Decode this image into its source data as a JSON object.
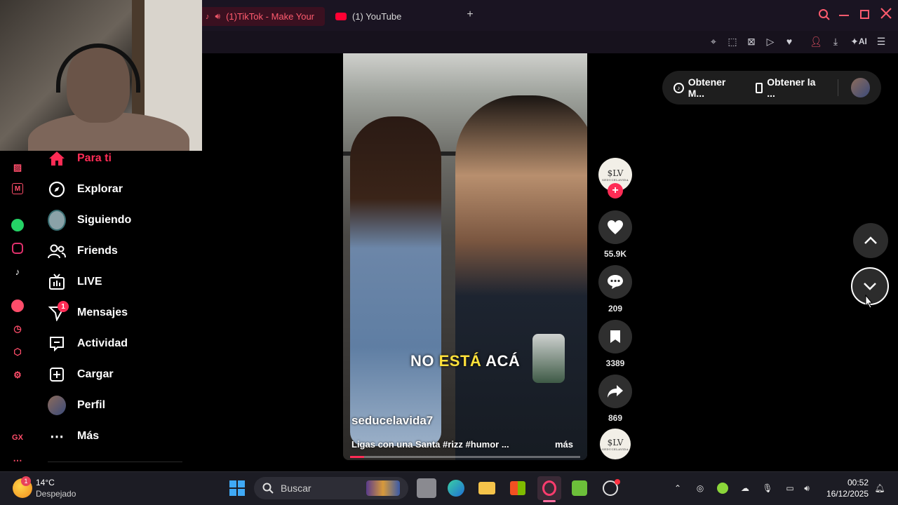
{
  "tabs": [
    {
      "label": "(1)TikTok - Make Your",
      "active": true
    },
    {
      "label": "(1) YouTube",
      "active": false
    }
  ],
  "new_tab": "+",
  "ai_label": "AI",
  "nav": [
    {
      "label": "Para ti",
      "icon": "home-icon",
      "active": true
    },
    {
      "label": "Explorar",
      "icon": "compass-icon"
    },
    {
      "label": "Siguiendo",
      "icon": "following-avatar-icon"
    },
    {
      "label": "Friends",
      "icon": "friends-icon"
    },
    {
      "label": "LIVE",
      "icon": "live-tv-icon"
    },
    {
      "label": "Mensajes",
      "icon": "send-icon",
      "badge": "1"
    },
    {
      "label": "Actividad",
      "icon": "message-icon"
    },
    {
      "label": "Cargar",
      "icon": "upload-plus-icon"
    },
    {
      "label": "Perfil",
      "icon": "profile-avatar-icon"
    },
    {
      "label": "Más",
      "icon": "more-dots-icon"
    }
  ],
  "opera_side_label": "GX",
  "video": {
    "caption_a": "NO",
    "caption_b": "ESTÁ",
    "caption_c": "ACÁ",
    "username": "seducelavida7",
    "description": "Ligas con una Santa #rizz #humor ...",
    "more": "más",
    "progress": 0.06
  },
  "actions": {
    "avatar_text": "$LV",
    "avatar_sub": "SEDUCELAVIDA",
    "likes": "55.9K",
    "comments": "209",
    "saves": "3389",
    "shares": "869"
  },
  "get_pill": {
    "item1": "Obtener M...",
    "item2": "Obtener la ..."
  },
  "taskbar": {
    "weather_temp": "14°C",
    "weather_desc": "Despejado",
    "weather_badge": "1",
    "search_placeholder": "Buscar",
    "time": "00:52",
    "date": "16/12/2025"
  },
  "colors": {
    "accent": "#fe2c55",
    "opera_red": "#ff5b6e",
    "caption_highlight": "#ffe13a"
  }
}
